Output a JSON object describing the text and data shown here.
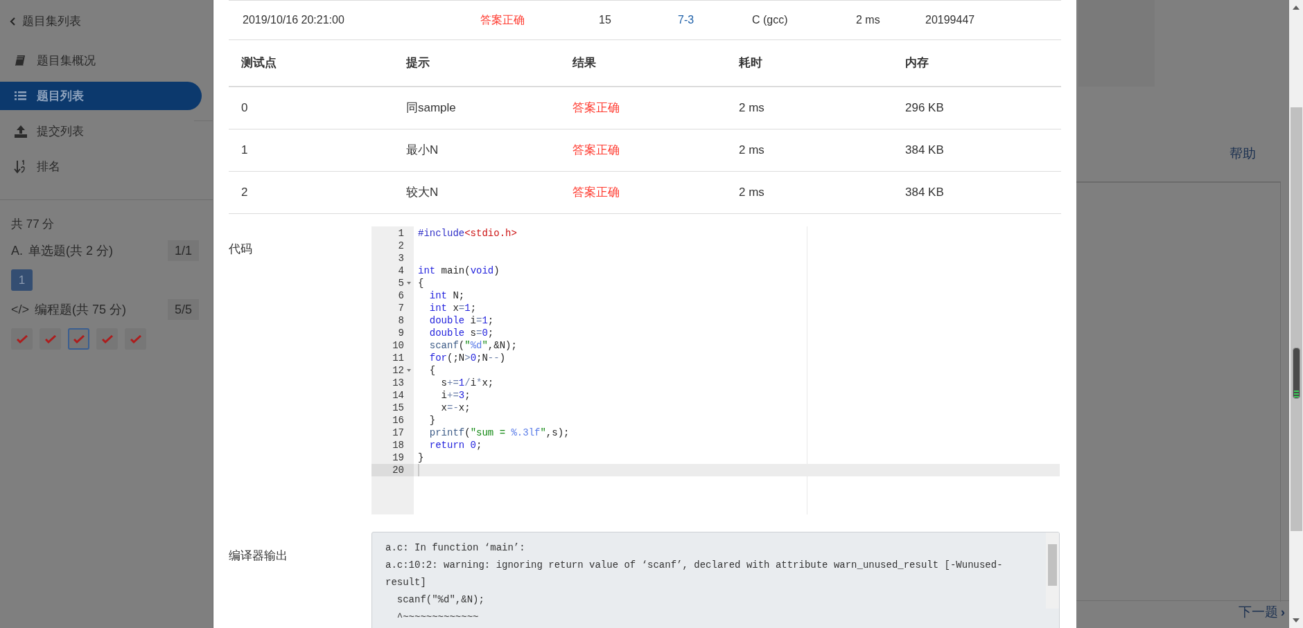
{
  "sidebar": {
    "back_link": "题目集列表",
    "nav": [
      {
        "label": "题目集概况",
        "selected": false
      },
      {
        "label": "题目列表",
        "selected": true
      },
      {
        "label": "提交列表",
        "selected": false
      },
      {
        "label": "排名",
        "selected": false
      }
    ],
    "total": "共 77 分",
    "sections": [
      {
        "marker": "A.",
        "title": "单选题(共 2 分)",
        "progress": "1/1",
        "questions": [
          {
            "kind": "number",
            "label": "1",
            "selected": false
          }
        ]
      },
      {
        "marker": "</>",
        "title": "编程题(共 75 分)",
        "progress": "5/5",
        "questions": [
          {
            "kind": "correct",
            "selected": false
          },
          {
            "kind": "correct",
            "selected": false
          },
          {
            "kind": "correct",
            "selected": true
          },
          {
            "kind": "correct",
            "selected": false
          },
          {
            "kind": "correct",
            "selected": false
          }
        ]
      }
    ]
  },
  "page": {
    "help_link": "帮助",
    "next_link": "下一题",
    "next_icon": "›"
  },
  "submission": {
    "time": "2019/10/16 20:21:00",
    "result": "答案正确",
    "score": "15",
    "problem": "7-3",
    "compiler": "C (gcc)",
    "time_used": "2 ms",
    "user": "20199447"
  },
  "tests": {
    "columns": [
      "测试点",
      "提示",
      "结果",
      "耗时",
      "内存"
    ],
    "rows": [
      [
        "0",
        "同sample",
        "答案正确",
        "2 ms",
        "296 KB"
      ],
      [
        "1",
        "最小N",
        "答案正确",
        "2 ms",
        "384 KB"
      ],
      [
        "2",
        "较大N",
        "答案正确",
        "2 ms",
        "384 KB"
      ]
    ]
  },
  "code": {
    "label": "代码",
    "lines": [
      {
        "number": "1",
        "foldable": false,
        "current": false,
        "tokens": [
          {
            "text": "#include",
            "kind": "meta"
          },
          {
            "text": "<stdio.h>",
            "kind": "header"
          }
        ]
      },
      {
        "number": "2",
        "foldable": false,
        "current": false
      },
      {
        "number": "3",
        "foldable": false,
        "current": false
      },
      {
        "number": "4",
        "foldable": false,
        "current": false,
        "tokens": [
          {
            "text": "int",
            "kind": "kw"
          },
          {
            "text": " main(",
            "kind": "plain"
          },
          {
            "text": "void",
            "kind": "kw"
          },
          {
            "text": ")",
            "kind": "plain"
          }
        ]
      },
      {
        "number": "5",
        "foldable": true,
        "current": false,
        "tokens": [
          {
            "text": "{",
            "kind": "plain"
          }
        ]
      },
      {
        "number": "6",
        "foldable": false,
        "current": false,
        "tokens": [
          {
            "text": "  int",
            "kind": "kw"
          },
          {
            "text": " N;",
            "kind": "plain"
          }
        ]
      },
      {
        "number": "7",
        "foldable": false,
        "current": false,
        "tokens": [
          {
            "text": "  int",
            "kind": "kw"
          },
          {
            "text": " x",
            "kind": "plain"
          },
          {
            "text": "=",
            "kind": "op"
          },
          {
            "text": "1",
            "kind": "num"
          },
          {
            "text": ";",
            "kind": "plain"
          }
        ]
      },
      {
        "number": "8",
        "foldable": false,
        "current": false,
        "tokens": [
          {
            "text": "  double",
            "kind": "kw"
          },
          {
            "text": " i",
            "kind": "plain"
          },
          {
            "text": "=",
            "kind": "op"
          },
          {
            "text": "1",
            "kind": "num"
          },
          {
            "text": ";",
            "kind": "plain"
          }
        ]
      },
      {
        "number": "9",
        "foldable": false,
        "current": false,
        "tokens": [
          {
            "text": "  double",
            "kind": "kw"
          },
          {
            "text": " s",
            "kind": "plain"
          },
          {
            "text": "=",
            "kind": "op"
          },
          {
            "text": "0",
            "kind": "num"
          },
          {
            "text": ";",
            "kind": "plain"
          }
        ]
      },
      {
        "number": "10",
        "foldable": false,
        "current": false,
        "tokens": [
          {
            "text": "  scanf",
            "kind": "builtin"
          },
          {
            "text": "(",
            "kind": "plain"
          },
          {
            "text": "\"",
            "kind": "str"
          },
          {
            "text": "%d",
            "kind": "fmt"
          },
          {
            "text": "\"",
            "kind": "str"
          },
          {
            "text": ",&N);",
            "kind": "plain"
          }
        ]
      },
      {
        "number": "11",
        "foldable": false,
        "current": false,
        "tokens": [
          {
            "text": "  for",
            "kind": "kw"
          },
          {
            "text": "(;N",
            "kind": "plain"
          },
          {
            "text": ">",
            "kind": "op"
          },
          {
            "text": "0",
            "kind": "num"
          },
          {
            "text": ";N",
            "kind": "plain"
          },
          {
            "text": "--",
            "kind": "op"
          },
          {
            "text": ")",
            "kind": "plain"
          }
        ]
      },
      {
        "number": "12",
        "foldable": true,
        "current": false,
        "tokens": [
          {
            "text": "  {",
            "kind": "plain"
          }
        ]
      },
      {
        "number": "13",
        "foldable": false,
        "current": false,
        "tokens": [
          {
            "text": "    s",
            "kind": "plain"
          },
          {
            "text": "+=",
            "kind": "op"
          },
          {
            "text": "1",
            "kind": "num"
          },
          {
            "text": "/",
            "kind": "op"
          },
          {
            "text": "i",
            "kind": "plain"
          },
          {
            "text": "*",
            "kind": "op"
          },
          {
            "text": "x;",
            "kind": "plain"
          }
        ]
      },
      {
        "number": "14",
        "foldable": false,
        "current": false,
        "tokens": [
          {
            "text": "    i",
            "kind": "plain"
          },
          {
            "text": "+=",
            "kind": "op"
          },
          {
            "text": "3",
            "kind": "num"
          },
          {
            "text": ";",
            "kind": "plain"
          }
        ]
      },
      {
        "number": "15",
        "foldable": false,
        "current": false,
        "tokens": [
          {
            "text": "    x",
            "kind": "plain"
          },
          {
            "text": "=-",
            "kind": "op"
          },
          {
            "text": "x;",
            "kind": "plain"
          }
        ]
      },
      {
        "number": "16",
        "foldable": false,
        "current": false,
        "tokens": [
          {
            "text": "  }",
            "kind": "plain"
          }
        ]
      },
      {
        "number": "17",
        "foldable": false,
        "current": false,
        "tokens": [
          {
            "text": "  printf",
            "kind": "builtin"
          },
          {
            "text": "(",
            "kind": "plain"
          },
          {
            "text": "\"sum = ",
            "kind": "str"
          },
          {
            "text": "%.3lf",
            "kind": "fmt"
          },
          {
            "text": "\"",
            "kind": "str"
          },
          {
            "text": ",s);",
            "kind": "plain"
          }
        ]
      },
      {
        "number": "18",
        "foldable": false,
        "current": false,
        "tokens": [
          {
            "text": "  return",
            "kind": "kw"
          },
          {
            "text": " 0",
            "kind": "num"
          },
          {
            "text": ";",
            "kind": "plain"
          }
        ]
      },
      {
        "number": "19",
        "foldable": false,
        "current": false,
        "tokens": [
          {
            "text": "}",
            "kind": "plain"
          }
        ]
      },
      {
        "number": "20",
        "foldable": false,
        "current": true
      }
    ]
  },
  "compiler_output": {
    "label": "编译器输出",
    "lines": [
      "a.c: In function ‘main’:",
      "a.c:10:2: warning: ignoring return value of ‘scanf’, declared with attribute warn_unused_result [-Wunused-result]",
      "  scanf(\"%d\",&N);",
      "  ^~~~~~~~~~~~~~"
    ]
  }
}
